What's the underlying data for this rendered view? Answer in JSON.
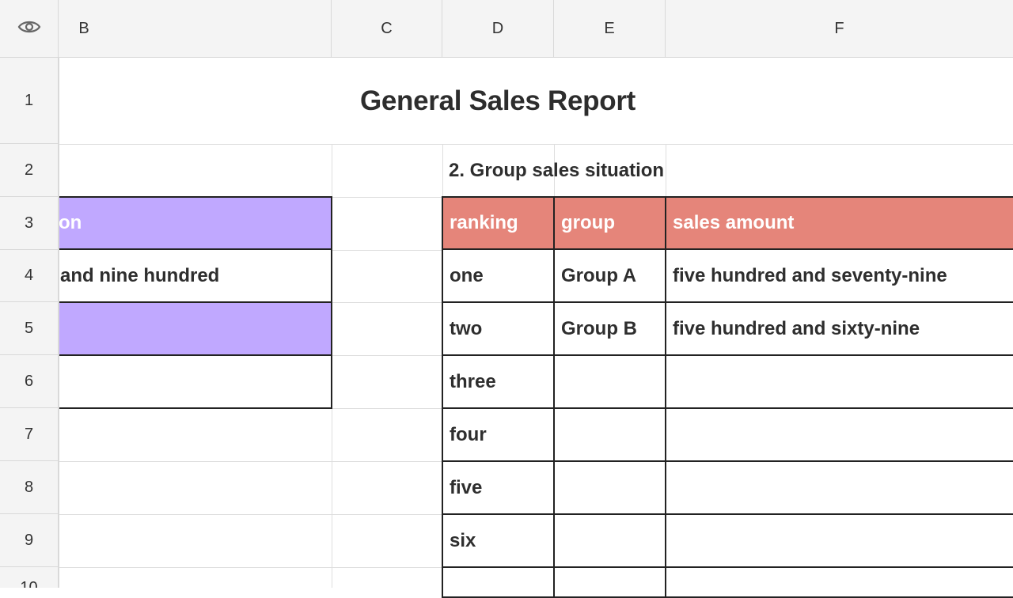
{
  "sheet": {
    "columns": [
      "B",
      "C",
      "D",
      "E",
      "F"
    ],
    "rows": [
      "1",
      "2",
      "3",
      "4",
      "5",
      "6",
      "7",
      "8",
      "9",
      "10"
    ],
    "title": "General Sales Report",
    "section2_title": "2. Group sales situation",
    "left_table": {
      "header_fragment": "on",
      "row4_fragment": "and nine hundred"
    },
    "group_table": {
      "headers": [
        "ranking",
        "group",
        "sales amount"
      ],
      "rows": [
        [
          "one",
          "Group A",
          "five hundred and seventy-nine"
        ],
        [
          "two",
          "Group B",
          "five hundred and sixty-nine"
        ],
        [
          "three",
          "",
          ""
        ],
        [
          "four",
          "",
          ""
        ],
        [
          "five",
          "",
          ""
        ],
        [
          "six",
          "",
          ""
        ]
      ]
    }
  },
  "icons": {
    "visibility": "eye-icon"
  },
  "colors": {
    "header_fill_left": "#c0a8ff",
    "header_fill_right": "#e5857a"
  }
}
